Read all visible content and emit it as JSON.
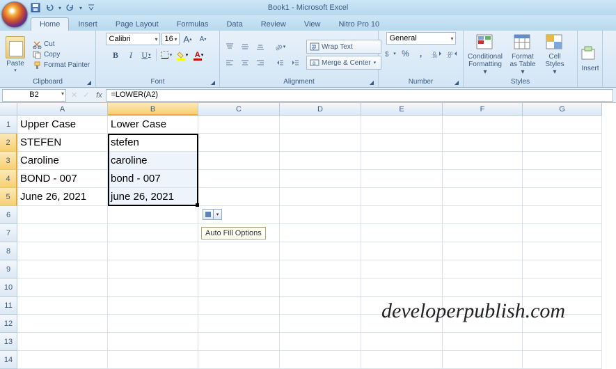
{
  "title": "Book1 - Microsoft Excel",
  "tabs": [
    "Home",
    "Insert",
    "Page Layout",
    "Formulas",
    "Data",
    "Review",
    "View",
    "Nitro Pro 10"
  ],
  "active_tab": 0,
  "clipboard": {
    "paste": "Paste",
    "cut": "Cut",
    "copy": "Copy",
    "painter": "Format Painter",
    "label": "Clipboard"
  },
  "font": {
    "name": "Calibri",
    "size": "16",
    "label": "Font"
  },
  "alignment": {
    "wrap": "Wrap Text",
    "merge": "Merge & Center",
    "label": "Alignment"
  },
  "number": {
    "format": "General",
    "label": "Number"
  },
  "styles": {
    "cond": "Conditional Formatting",
    "table": "Format as Table",
    "cell": "Cell Styles",
    "label": "Styles"
  },
  "cells": {
    "insert": "Insert"
  },
  "namebox": "B2",
  "formula": "=LOWER(A2)",
  "columns": [
    "A",
    "B",
    "C",
    "D",
    "E",
    "F",
    "G"
  ],
  "rows": {
    "1": {
      "A": "Upper Case",
      "B": "Lower Case"
    },
    "2": {
      "A": "STEFEN",
      "B": "stefen"
    },
    "3": {
      "A": "Caroline",
      "B": "caroline"
    },
    "4": {
      "A": "BOND - 007",
      "B": "bond - 007"
    },
    "5": {
      "A": "June 26, 2021",
      "B": "june 26, 2021"
    }
  },
  "autofill_tooltip": "Auto Fill Options",
  "watermark": "developerpublish.com"
}
